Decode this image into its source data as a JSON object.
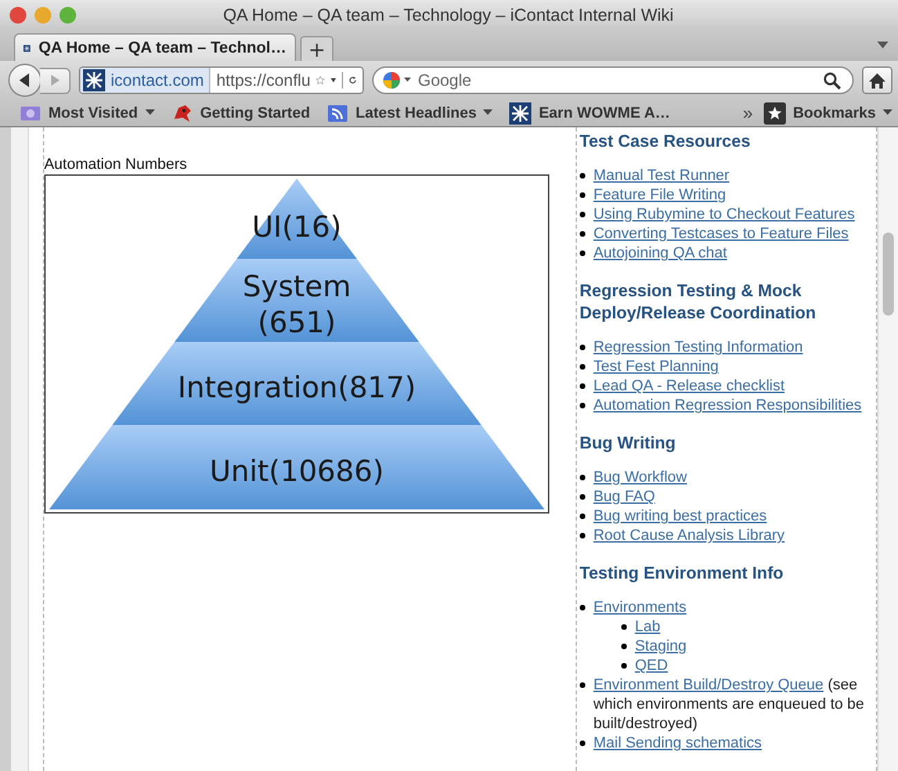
{
  "window": {
    "title": "QA Home – QA team – Technology – iContact Internal Wiki"
  },
  "tabs": [
    {
      "label": "QA Home – QA team – Technol…",
      "selected": true
    }
  ],
  "new_tab": "+",
  "toolbar": {
    "site_identity": "icontact.com",
    "url": "https://conflu",
    "search": {
      "placeholder": "Google"
    }
  },
  "bookmarks": [
    {
      "label": "Most Visited",
      "menu": true,
      "kind": "folder"
    },
    {
      "label": "Getting Started",
      "menu": false,
      "kind": "page"
    },
    {
      "label": "Latest Headlines",
      "menu": true,
      "kind": "feed"
    },
    {
      "label": "Earn WOWME A…",
      "menu": false,
      "kind": "site"
    }
  ],
  "bookmarks_overflow": "»",
  "bookmarks_menu": "Bookmarks",
  "figure": {
    "caption": "Automation Numbers",
    "tiers": [
      {
        "lines": [
          "UI(16)"
        ]
      },
      {
        "lines": [
          "System",
          "(651)"
        ]
      },
      {
        "lines": [
          "Integration(817)"
        ]
      },
      {
        "lines": [
          "Unit(10686)"
        ]
      }
    ]
  },
  "sidebar": {
    "sections": [
      {
        "heading": "Test Case Resources",
        "items": [
          {
            "link": "Manual Test Runner"
          },
          {
            "link": "Feature File Writing"
          },
          {
            "link": "Using Rubymine to Checkout Features"
          },
          {
            "link": "Converting Testcases to Feature Files"
          },
          {
            "link": "Autojoining QA chat"
          }
        ]
      },
      {
        "heading": "Regression Testing & Mock Deploy/Release Coordination",
        "items": [
          {
            "link": "Regression Testing Information"
          },
          {
            "link": "Test Fest Planning"
          },
          {
            "link": "Lead QA - Release checklist"
          },
          {
            "link": "Automation Regression Responsibilities"
          }
        ]
      },
      {
        "heading": "Bug Writing",
        "items": [
          {
            "link": "Bug Workflow"
          },
          {
            "link": "Bug FAQ"
          },
          {
            "link": "Bug writing best practices"
          },
          {
            "link": "Root Cause Analysis Library"
          }
        ]
      },
      {
        "heading": "Testing Environment Info",
        "items": [
          {
            "link": "Environments",
            "children": [
              {
                "link": "Lab"
              },
              {
                "link": "Staging"
              },
              {
                "link": "QED"
              }
            ]
          },
          {
            "link": "Environment Build/Destroy Queue",
            "note": "(see which environments are enqueued to be built/destroyed)"
          },
          {
            "link": "Mail Sending schematics"
          }
        ]
      }
    ]
  }
}
